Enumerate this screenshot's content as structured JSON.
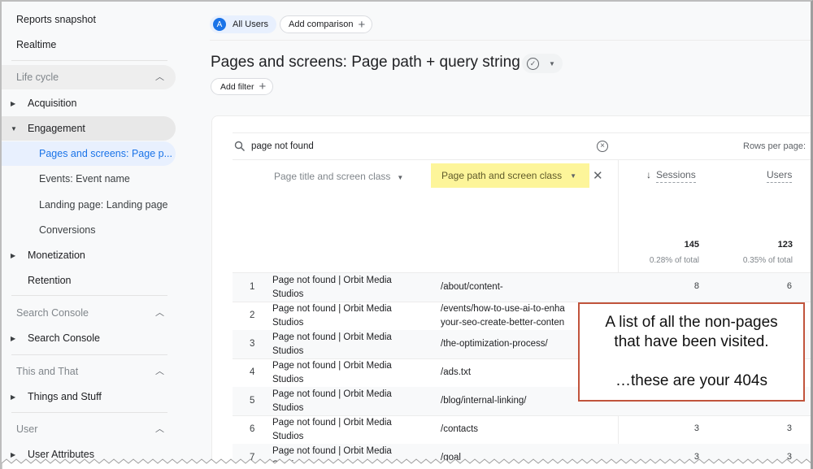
{
  "sidebar": {
    "top_items": [
      {
        "label": "Reports snapshot"
      },
      {
        "label": "Realtime"
      }
    ],
    "sections": [
      {
        "header": "Life cycle",
        "items": [
          {
            "label": "Acquisition",
            "expanded": false
          },
          {
            "label": "Engagement",
            "expanded": true,
            "children": [
              {
                "label": "Pages and screens: Page p...",
                "selected": true
              },
              {
                "label": "Events: Event name"
              },
              {
                "label": "Landing page: Landing page"
              },
              {
                "label": "Conversions"
              }
            ]
          },
          {
            "label": "Monetization",
            "expanded": false
          },
          {
            "label": "Retention"
          }
        ]
      },
      {
        "header": "Search Console",
        "items": [
          {
            "label": "Search Console",
            "expanded": false
          }
        ]
      },
      {
        "header": "This and That",
        "items": [
          {
            "label": "Things and Stuff",
            "expanded": false
          }
        ]
      },
      {
        "header": "User",
        "items": [
          {
            "label": "User Attributes",
            "expanded": false
          }
        ]
      }
    ]
  },
  "header": {
    "segment_avatar": "A",
    "segment_label": "All Users",
    "add_comparison": "Add comparison",
    "page_title": "Pages and screens: Page path + query string",
    "add_filter": "Add filter"
  },
  "table": {
    "search_value": "page not found",
    "rows_per_page_label": "Rows per page:",
    "dimension_1": "Page title and screen class",
    "dimension_2": "Page path and screen class",
    "metrics": [
      {
        "label": "Sessions",
        "sorted": "desc",
        "total": "145",
        "pct": "0.28% of total"
      },
      {
        "label": "Users",
        "total": "123",
        "pct": "0.35% of total"
      }
    ],
    "rows": [
      {
        "idx": "1",
        "title_l1": "Page not found | Orbit Media",
        "title_l2": "Studios",
        "path_l1": "/about/content-",
        "path_l2": "",
        "sessions": "8",
        "users": "6"
      },
      {
        "idx": "2",
        "title_l1": "Page not found | Orbit Media",
        "title_l2": "Studios",
        "path_l1": "/events/how-to-use-ai-to-enha",
        "path_l2": "your-seo-create-better-conten",
        "sessions": "",
        "users": ""
      },
      {
        "idx": "3",
        "title_l1": "Page not found | Orbit Media",
        "title_l2": "Studios",
        "path_l1": "/the-optimization-process/",
        "path_l2": "",
        "sessions": "",
        "users": ""
      },
      {
        "idx": "4",
        "title_l1": "Page not found | Orbit Media",
        "title_l2": "Studios",
        "path_l1": "/ads.txt",
        "path_l2": "",
        "sessions": "",
        "users": ""
      },
      {
        "idx": "5",
        "title_l1": "Page not found | Orbit Media",
        "title_l2": "Studios",
        "path_l1": "/blog/internal-linking/",
        "path_l2": "",
        "sessions": "",
        "users": ""
      },
      {
        "idx": "6",
        "title_l1": "Page not found | Orbit Media",
        "title_l2": "Studios",
        "path_l1": "/contacts",
        "path_l2": "",
        "sessions": "3",
        "users": "3"
      },
      {
        "idx": "7",
        "title_l1": "Page not found | Orbit Media",
        "title_l2": "Studios",
        "path_l1": "/goal",
        "path_l2": "",
        "sessions": "3",
        "users": "3"
      }
    ]
  },
  "callout": {
    "line1": "A list of all the non-pages",
    "line2": "that have been visited.",
    "line3": "…these are your 404s",
    "border_color": "#c1543c"
  },
  "colors": {
    "accent": "#1a73e8",
    "highlight": "#fdf59a",
    "selected_bg": "#e8f0fe"
  }
}
